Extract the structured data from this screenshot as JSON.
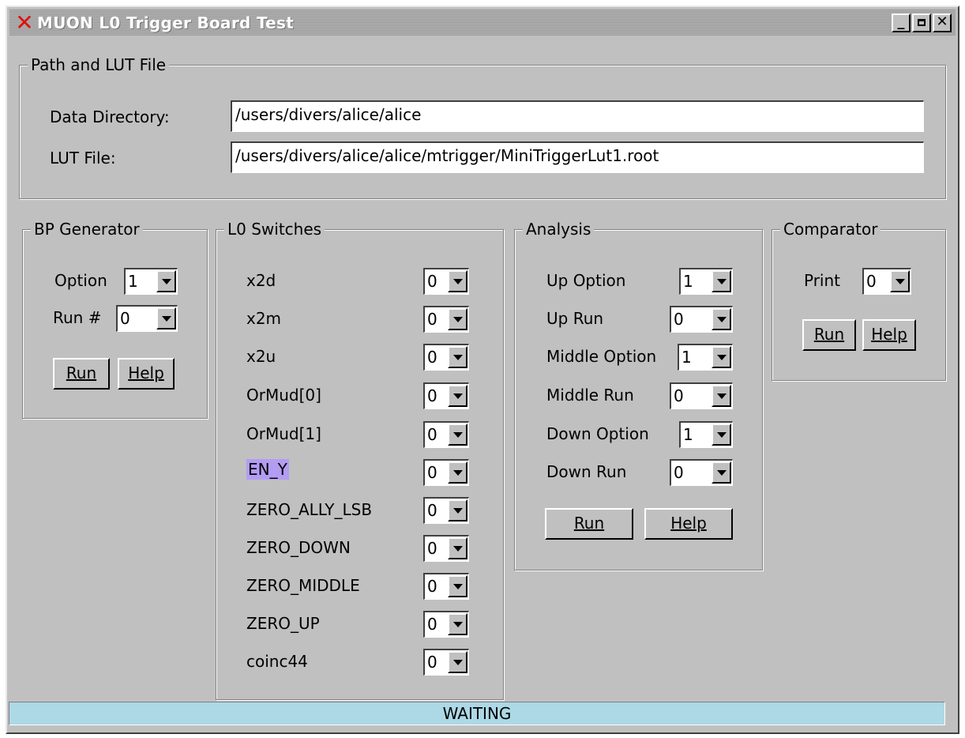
{
  "window": {
    "title": "MUON L0 Trigger Board Test",
    "icon": "x-close-icon"
  },
  "path_group": {
    "title": "Path and LUT File",
    "data_dir_label": "Data Directory:",
    "data_dir_value": "/users/divers/alice/alice",
    "lut_label": "LUT File:",
    "lut_value": "/users/divers/alice/alice/mtrigger/MiniTriggerLut1.root"
  },
  "bp": {
    "title": "BP Generator",
    "option_label": "Option",
    "option_value": "1",
    "run_label": "Run #",
    "run_value": "0",
    "run_btn": "Run",
    "help_btn": "Help"
  },
  "l0": {
    "title": "L0 Switches",
    "items": [
      {
        "label": "x2d",
        "value": "0"
      },
      {
        "label": "x2m",
        "value": "0"
      },
      {
        "label": "x2u",
        "value": "0"
      },
      {
        "label": "OrMud[0]",
        "value": "0"
      },
      {
        "label": "OrMud[1]",
        "value": "0"
      },
      {
        "label": "EN_Y",
        "value": "0"
      },
      {
        "label": "ZERO_ALLY_LSB",
        "value": "0"
      },
      {
        "label": "ZERO_DOWN",
        "value": "0"
      },
      {
        "label": "ZERO_MIDDLE",
        "value": "0"
      },
      {
        "label": "ZERO_UP",
        "value": "0"
      },
      {
        "label": "coinc44",
        "value": "0"
      }
    ]
  },
  "analysis": {
    "title": "Analysis",
    "items": [
      {
        "label": "Up Option",
        "value": "1"
      },
      {
        "label": "Up Run",
        "value": "0"
      },
      {
        "label": "Middle Option",
        "value": "1"
      },
      {
        "label": "Middle Run",
        "value": "0"
      },
      {
        "label": "Down Option",
        "value": "1"
      },
      {
        "label": "Down Run",
        "value": "0"
      }
    ],
    "run_btn": "Run",
    "help_btn": "Help"
  },
  "comparator": {
    "title": "Comparator",
    "print_label": "Print",
    "print_value": "0",
    "run_btn": "Run",
    "help_btn": "Help"
  },
  "status": "WAITING"
}
